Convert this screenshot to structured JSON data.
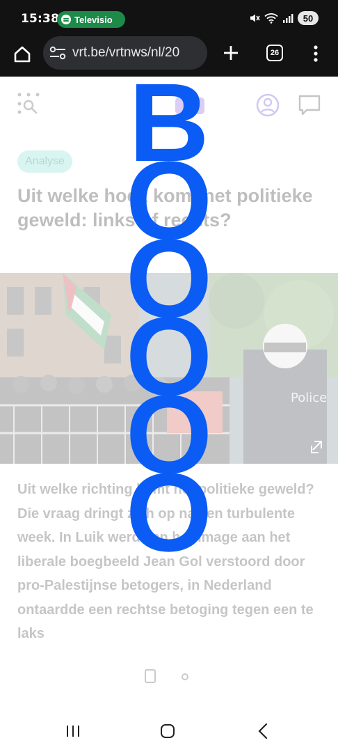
{
  "status_bar": {
    "time": "15:38",
    "notification_text": "Televisio",
    "battery": "50"
  },
  "browser": {
    "url": "vrt.be/vrtnws/nl/20",
    "tab_count": "26"
  },
  "article": {
    "tag": "Analyse",
    "headline": "Uit welke hoek komt het politieke geweld: links of rechts?",
    "body": "Uit welke richting komt het politieke geweld? Die vraag dringt zich op na een turbulente week. In Luik werd een hommage aan het liberale boegbeeld Jean Gol verstoord door pro-Palestijnse betogers, in Nederland ontaardde een rechtse betoging tegen een te laks"
  },
  "overlay": {
    "text": "BOOOOO",
    "color": "#0a5cf5"
  },
  "colors": {
    "tag_bg": "#7adccf",
    "brand_purple": "#7b4be0",
    "status_green": "#1d8a4a"
  }
}
